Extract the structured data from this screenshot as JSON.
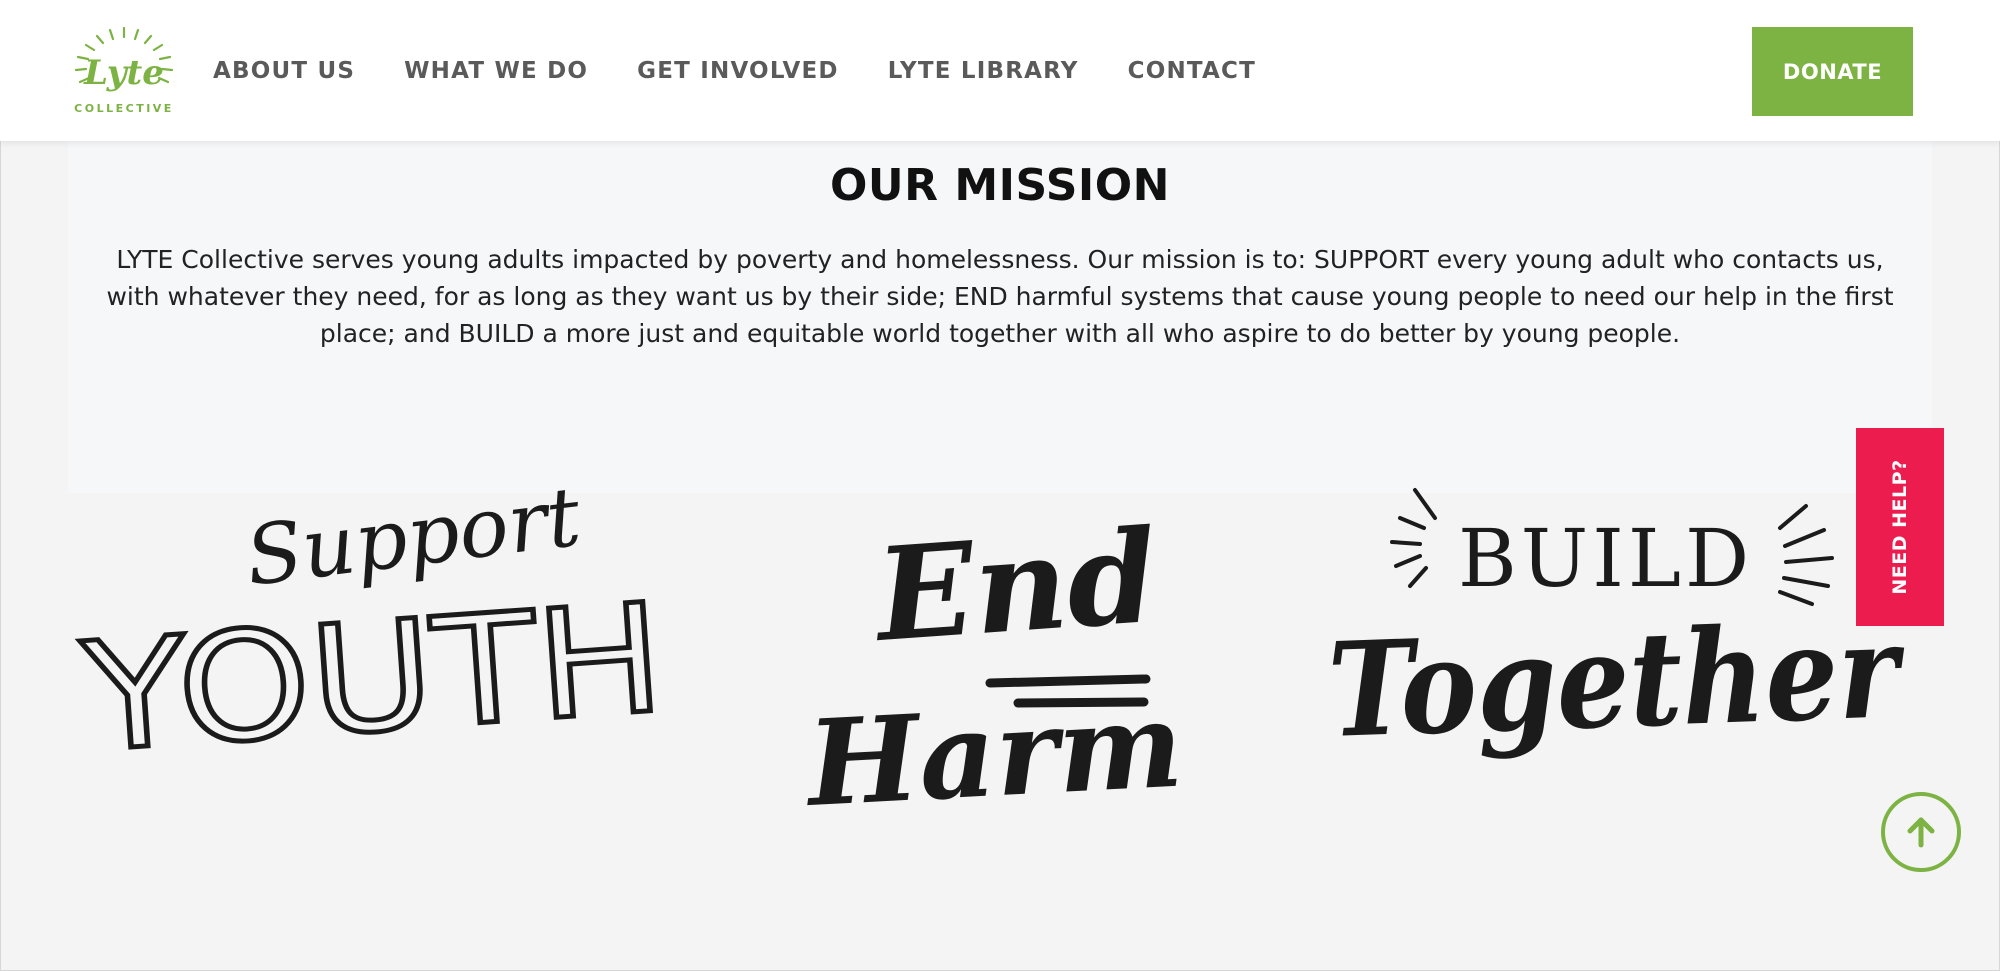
{
  "brand": {
    "logo_text": "Lyte",
    "logo_subtext": "COLLECTIVE",
    "accent_color": "#7cb342",
    "alert_color": "#ec1c4f"
  },
  "nav": {
    "items": [
      {
        "label": "ABOUT US"
      },
      {
        "label": "WHAT WE DO"
      },
      {
        "label": "GET INVOLVED"
      },
      {
        "label": "LYTE LIBRARY"
      },
      {
        "label": "CONTACT"
      }
    ],
    "donate_label": "DONATE"
  },
  "mission": {
    "title": "OUR MISSION",
    "body": "LYTE Collective serves young adults impacted by poverty and homelessness. Our mission is to: SUPPORT every young adult who contacts us, with whatever they need, for as long as they want us by their side; END harmful systems that cause young people to need our help in the first place; and BUILD a more just and equitable world together with all who aspire to do better by young people."
  },
  "pillars": [
    {
      "line1": "Support",
      "line2": "YOUTH"
    },
    {
      "line1": "End",
      "line2": "Harm"
    },
    {
      "line1": "BUILD",
      "line2": "Together"
    }
  ],
  "widgets": {
    "need_help_label": "NEED HELP?",
    "back_to_top_icon": "arrow-up-icon"
  }
}
